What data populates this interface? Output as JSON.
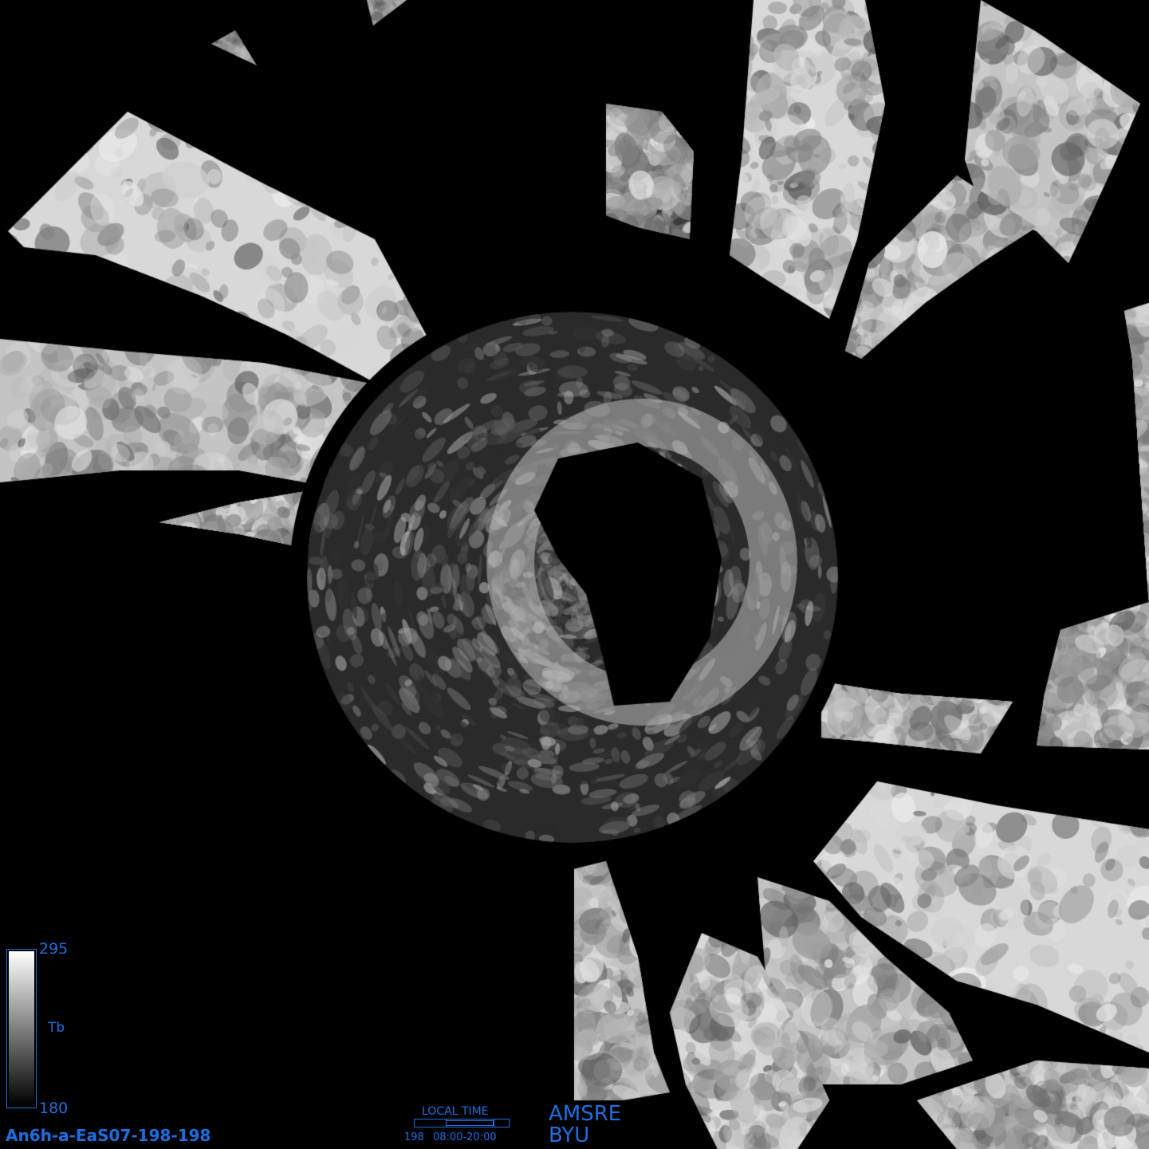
{
  "map": {
    "sensor_label": "AMSRE",
    "org_label": "BYU",
    "file_id": "An6h-a-EaS07-198-198",
    "colorbar": {
      "max_label": "295",
      "min_label": "180",
      "variable_label": "Tb",
      "top_color": "#ffffff",
      "bottom_color": "#000000",
      "border_color": "#1c6fe0"
    },
    "local_time": {
      "title": "LOCAL TIME",
      "day": "198",
      "range": "08:00-20:00"
    },
    "colors": {
      "background": "#000000",
      "text": "#1c6fe0"
    }
  }
}
